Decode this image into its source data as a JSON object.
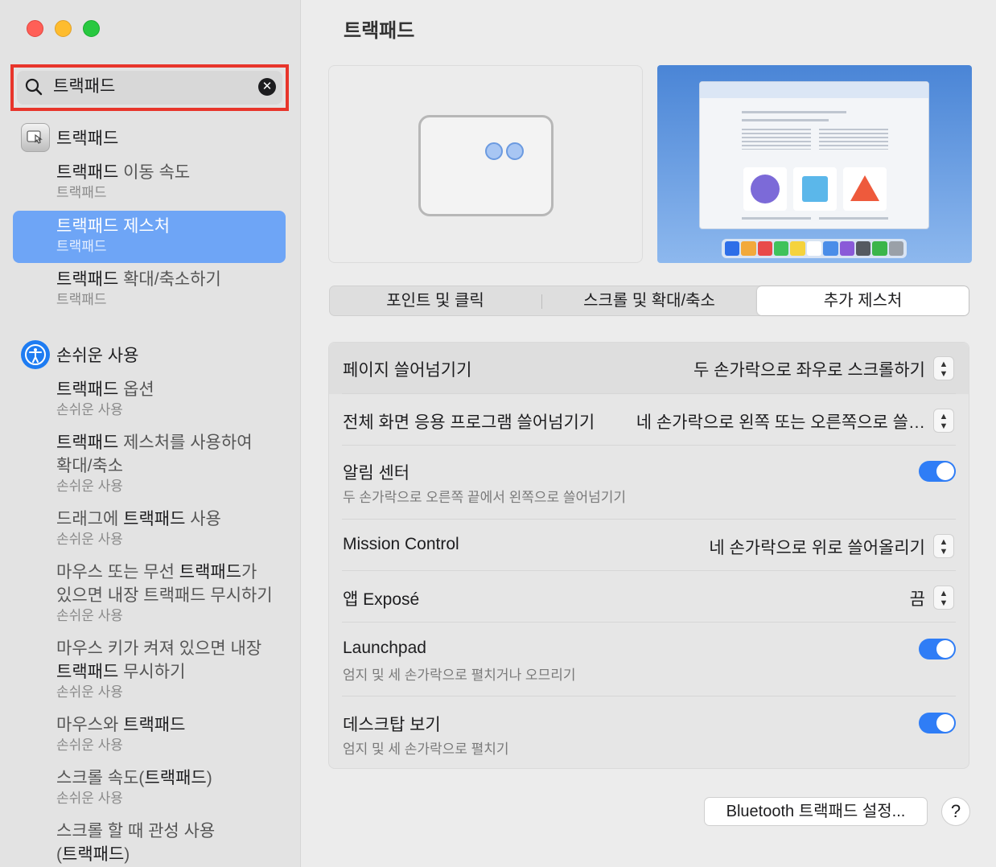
{
  "search": {
    "value": "트랙패드"
  },
  "sidebar": {
    "groups": [
      {
        "label": "트랙패드",
        "icon": "trackpad-icon"
      },
      {
        "label": "손쉬운 사용",
        "icon": "accessibility-icon"
      }
    ],
    "items": [
      {
        "title_bold": "트랙패드",
        "title_rest": " 이동 속도",
        "sub": "트랙패드"
      },
      {
        "title_bold": "트랙패드",
        "title_rest": " 제스처",
        "sub": "트랙패드"
      },
      {
        "title_bold": "트랙패드",
        "title_rest": " 확대/축소하기",
        "sub": "트랙패드"
      },
      {
        "title_bold": "트랙패드",
        "title_rest": " 옵션",
        "sub": "손쉬운 사용"
      },
      {
        "title_bold": "트랙패드",
        "title_rest": " 제스처를 사용하여",
        "title_line2": "확대/축소",
        "sub": "손쉬운 사용"
      },
      {
        "title_pre": "드래그에 ",
        "title_bold": "트랙패드",
        "title_rest": " 사용",
        "sub": "손쉬운 사용"
      },
      {
        "title_pre": "마우스 또는 무선 ",
        "title_bold": "트랙패드",
        "title_rest": "가",
        "title_line2": "있으면 내장 트랙패드 무시하기",
        "sub": "손쉬운 사용"
      },
      {
        "title_pre": "마우스 키가 켜져 있으면 내장",
        "title_line2_bold": "트랙패드",
        "title_line2_rest": " 무시하기",
        "sub": "손쉬운 사용"
      },
      {
        "title_pre": "마우스와 ",
        "title_bold": "트랙패드",
        "sub": "손쉬운 사용"
      },
      {
        "title_pre": "스크롤 속도(",
        "title_bold": "트랙패드",
        "title_rest": ")",
        "sub": "손쉬운 사용"
      },
      {
        "title_pre": "스크롤 할 때 관성 사용",
        "title_line2_pre": "(",
        "title_line2_bold": "트랙패드",
        "title_line2_rest": ")"
      }
    ]
  },
  "main": {
    "title": "트랙패드",
    "tabs": [
      {
        "label": "포인트 및 클릭"
      },
      {
        "label": "스크롤 및 확대/축소"
      },
      {
        "label": "추가 제스처"
      }
    ],
    "rows": [
      {
        "label": "페이지 쓸어넘기기",
        "value": "두 손가락으로 좌우로 스크롤하기"
      },
      {
        "label": "전체 화면 응용 프로그램 쓸어넘기기",
        "value": "네 손가락으로 왼쪽 또는 오른쪽으로 쓸…"
      },
      {
        "label": "알림 센터",
        "sub": "두 손가락으로 오른쪽 끝에서 왼쪽으로 쓸어넘기기",
        "toggle": true
      },
      {
        "label": "Mission Control",
        "value": "네 손가락으로 위로 쓸어올리기"
      },
      {
        "label": "앱 Exposé",
        "value": "끔"
      },
      {
        "label": "Launchpad",
        "sub": "엄지 및 세 손가락으로 펼치거나 오므리기",
        "toggle": true
      },
      {
        "label": "데스크탑 보기",
        "sub": "엄지 및 세 손가락으로 펼치기",
        "toggle": true
      }
    ],
    "bluetooth_button": "Bluetooth 트랙패드 설정...",
    "help_button": "?"
  },
  "colors": {
    "accent": "#2f7df6",
    "selected_sidebar": "#6ea5f6",
    "search_highlight": "#e8352b"
  }
}
